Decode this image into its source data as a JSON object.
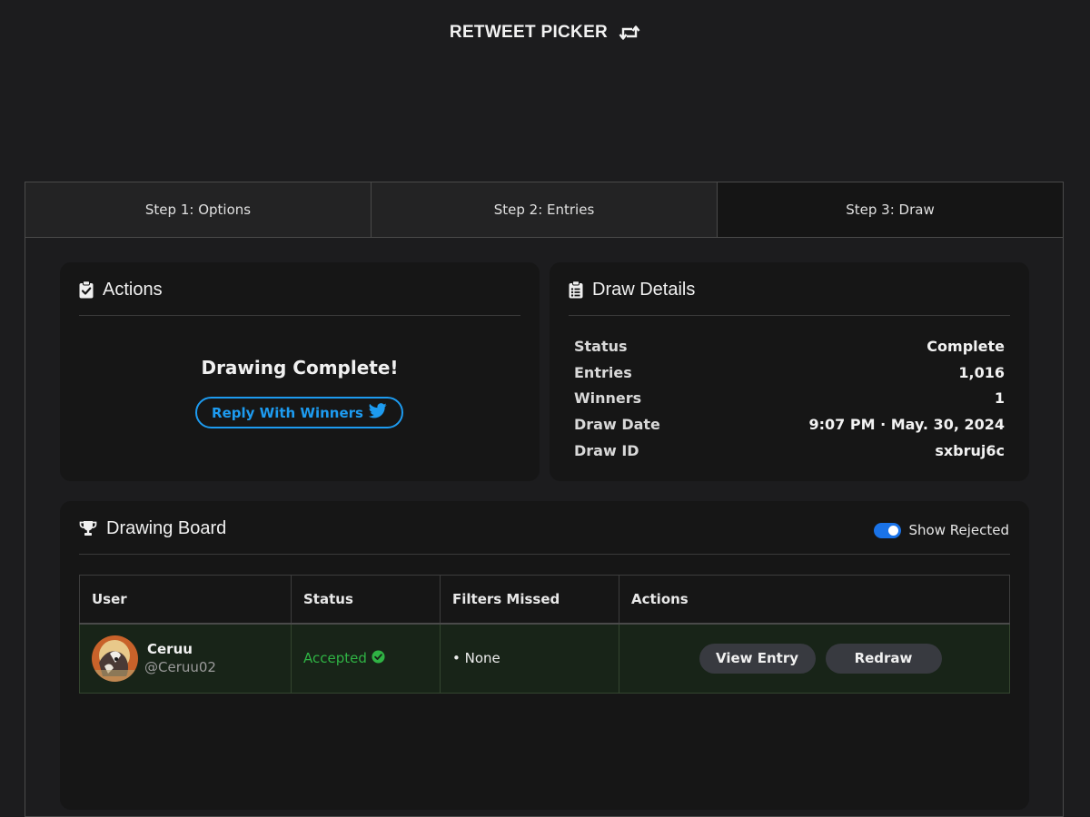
{
  "header": {
    "title": "RETWEET PICKER",
    "icon": "retweet-icon"
  },
  "tabs": [
    {
      "label": "Step 1: Options"
    },
    {
      "label": "Step 2: Entries"
    },
    {
      "label": "Step 3: Draw",
      "active": true
    }
  ],
  "actions_card": {
    "title": "Actions",
    "icon": "clipboard-check-icon",
    "message": "Drawing Complete!",
    "reply_button": "Reply With Winners",
    "reply_icon": "twitter-bird-icon"
  },
  "details_card": {
    "title": "Draw Details",
    "icon": "clipboard-list-icon",
    "rows": [
      {
        "label": "Status",
        "value": "Complete"
      },
      {
        "label": "Entries",
        "value": "1,016"
      },
      {
        "label": "Winners",
        "value": "1"
      },
      {
        "label": "Draw Date",
        "value": "9:07 PM · May. 30, 2024"
      },
      {
        "label": "Draw ID",
        "value": "sxbruj6c"
      }
    ]
  },
  "board": {
    "title": "Drawing Board",
    "icon": "trophy-icon",
    "toggle": {
      "label": "Show Rejected",
      "on": true
    },
    "columns": [
      "User",
      "Status",
      "Filters Missed",
      "Actions"
    ],
    "rows": [
      {
        "name": "Ceruu",
        "handle": "@Ceruu02",
        "status": "Accepted",
        "filters_missed": "• None",
        "view_button": "View Entry",
        "redraw_button": "Redraw"
      }
    ]
  },
  "colors": {
    "accent": "#1d9bf0",
    "accepted": "#2fb344",
    "toggle": "#1a73e8"
  }
}
